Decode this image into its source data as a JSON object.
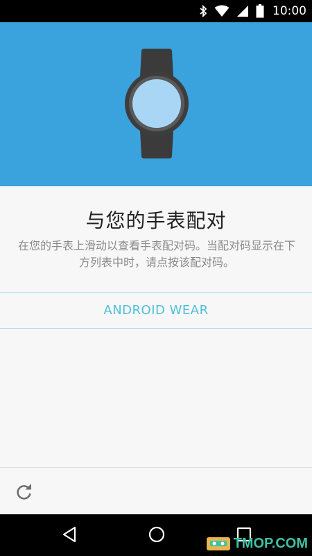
{
  "status_bar": {
    "time": "10:00",
    "icons": [
      "bluetooth-icon",
      "wifi-icon",
      "signal-icon",
      "battery-icon"
    ]
  },
  "hero": {
    "background_color": "#3aa3de",
    "illustration": "watch-icon"
  },
  "pairing": {
    "title": "与您的手表配对",
    "description": "在您的手表上滑动以查看手表配对码。当配对码显示在下方列表中时，请点按该配对码。",
    "devices": [
      "ANDROID WEAR"
    ]
  },
  "bottom_bar": {
    "refresh_icon": "refresh-icon"
  },
  "nav_bar": {
    "icons": [
      "back-icon",
      "home-icon",
      "recents-icon"
    ]
  },
  "watermark": {
    "text": "TMOP.COM"
  },
  "colors": {
    "accent": "#4fc0d9",
    "hero": "#3aa3de",
    "divider": "#b9dce9"
  }
}
